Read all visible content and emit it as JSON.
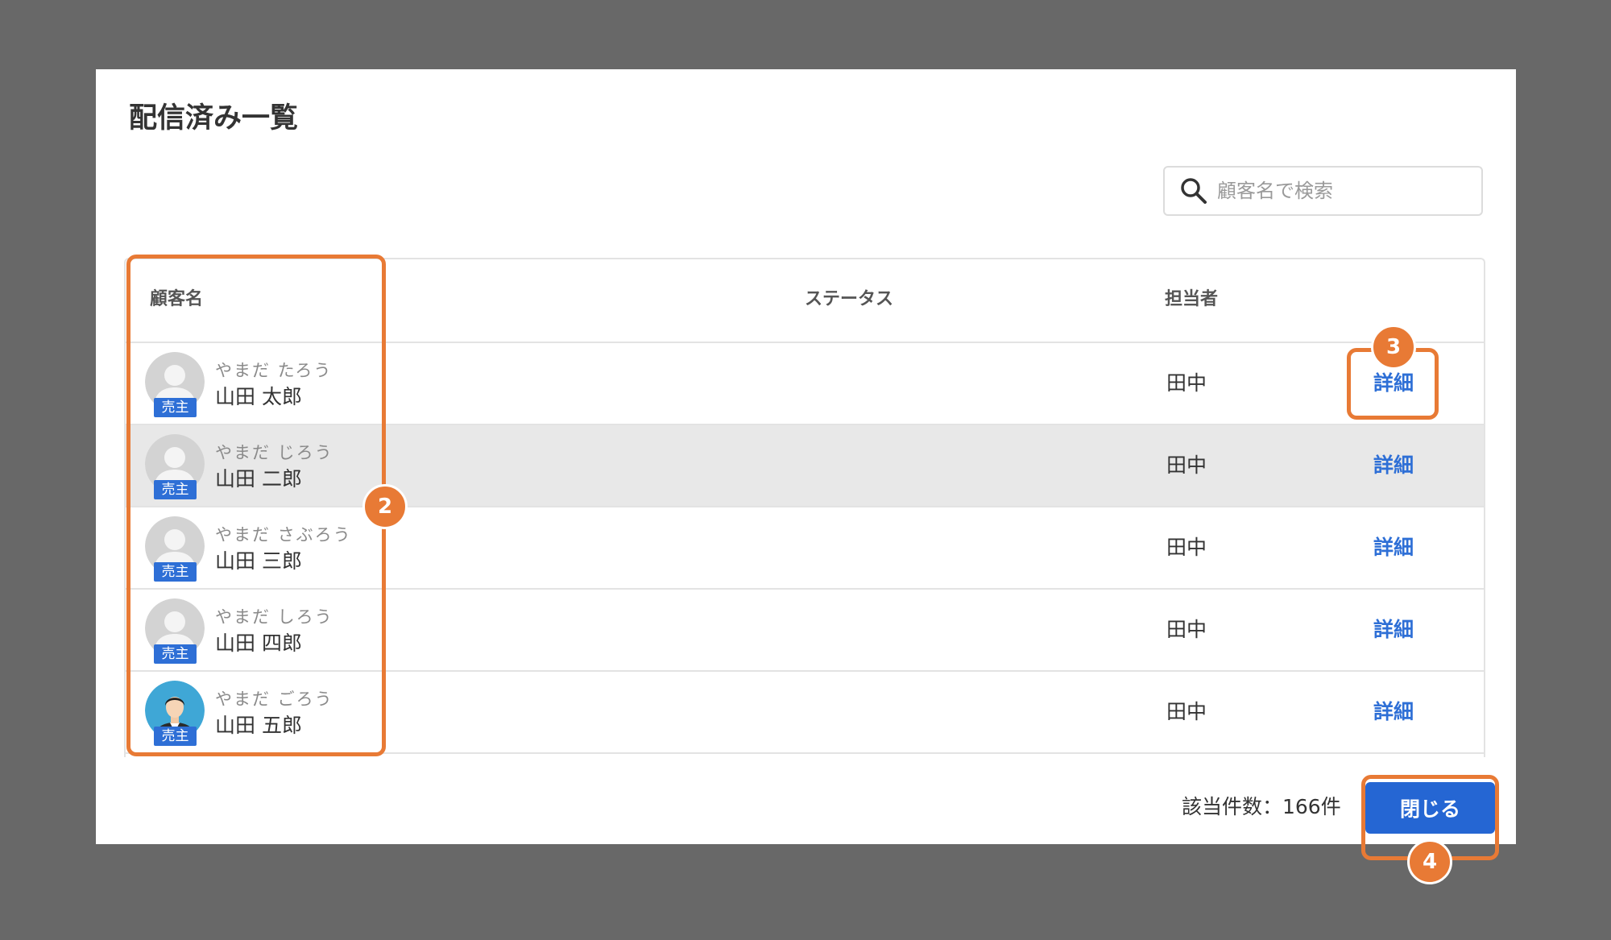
{
  "modal": {
    "title": "配信済み一覧"
  },
  "search": {
    "placeholder": "顧客名で検索"
  },
  "table": {
    "headers": {
      "name": "顧客名",
      "status": "ステータス",
      "staff": "担当者"
    },
    "rows": [
      {
        "kana": "やまだ たろう",
        "name": "山田 太郎",
        "badge": "売主",
        "staff": "田中",
        "action": "詳細",
        "avatar": "placeholder",
        "highlighted": false
      },
      {
        "kana": "やまだ じろう",
        "name": "山田 二郎",
        "badge": "売主",
        "staff": "田中",
        "action": "詳細",
        "avatar": "placeholder",
        "highlighted": true
      },
      {
        "kana": "やまだ さぶろう",
        "name": "山田 三郎",
        "badge": "売主",
        "staff": "田中",
        "action": "詳細",
        "avatar": "placeholder",
        "highlighted": false
      },
      {
        "kana": "やまだ しろう",
        "name": "山田 四郎",
        "badge": "売主",
        "staff": "田中",
        "action": "詳細",
        "avatar": "placeholder",
        "highlighted": false
      },
      {
        "kana": "やまだ ごろう",
        "name": "山田 五郎",
        "badge": "売主",
        "staff": "田中",
        "action": "詳細",
        "avatar": "photo",
        "highlighted": false
      }
    ]
  },
  "footer": {
    "result_count": "該当件数：166件",
    "close_label": "閉じる"
  },
  "annotations": [
    {
      "number": "2",
      "target": "customer-name-column"
    },
    {
      "number": "3",
      "target": "detail-link"
    },
    {
      "number": "4",
      "target": "close-button"
    }
  ],
  "colors": {
    "backdrop": "#686868",
    "accent_blue": "#2e6fd6",
    "callout_orange": "#e87a35",
    "highlight_row": "#e8e8e8"
  }
}
